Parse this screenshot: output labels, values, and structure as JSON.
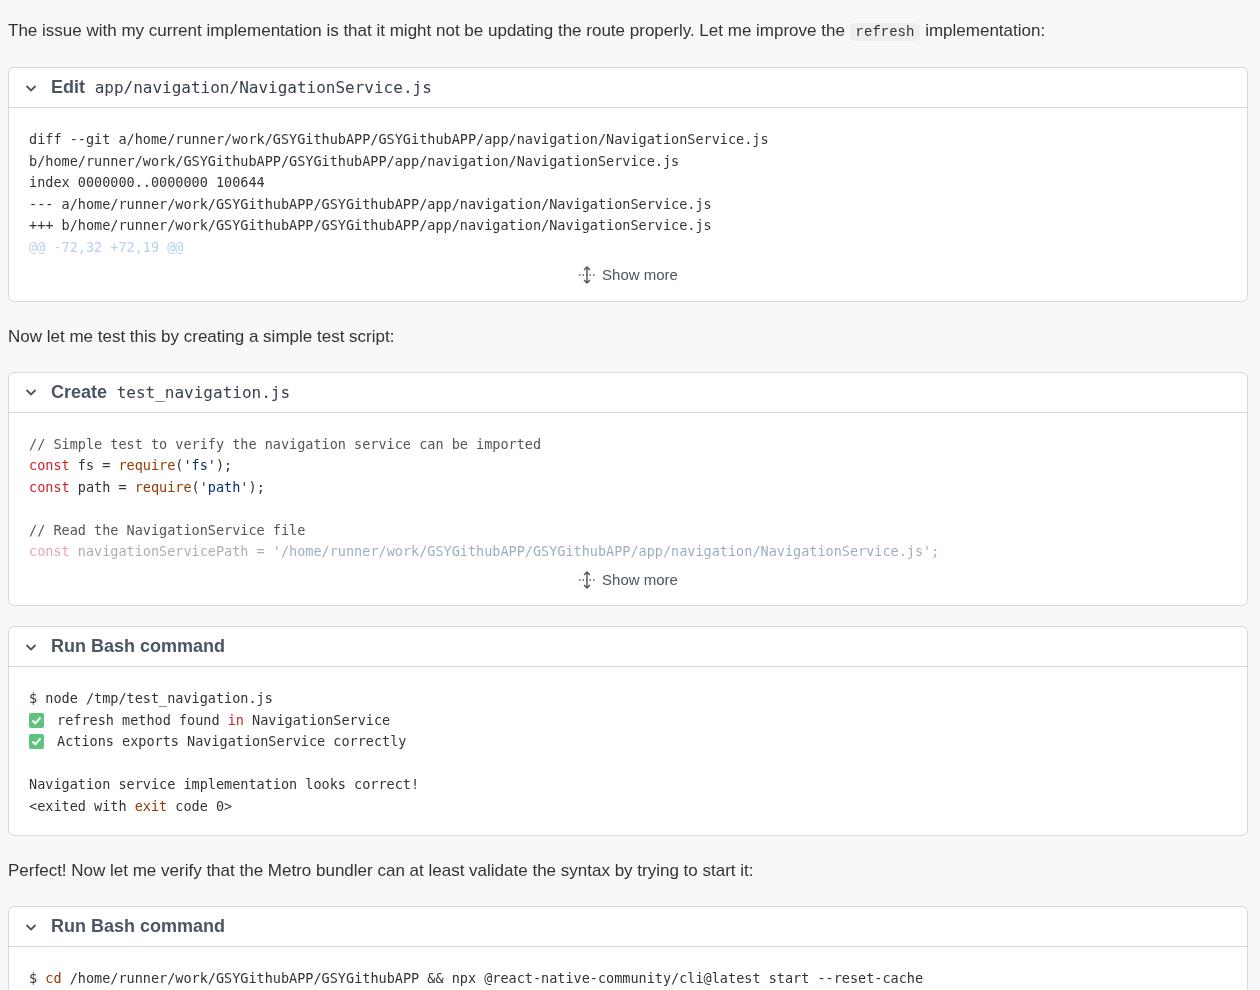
{
  "blocks": [
    {
      "kind": "text",
      "parts": [
        {
          "kind": "plain",
          "text": "The issue with my current implementation is that it might not be updating the route properly. Let me improve the "
        },
        {
          "kind": "code",
          "text": "refresh"
        },
        {
          "kind": "plain",
          "text": " implementation:"
        }
      ]
    },
    {
      "kind": "tool",
      "expanded": true,
      "action": "Edit",
      "target": "app/navigation/NavigationService.js",
      "show_more": "Show more",
      "lines": [
        {
          "kind": "line",
          "faded": false,
          "segs": [
            {
              "kind": "plain",
              "text": "diff --git a/home/runner/work/GSYGithubAPP/GSYGithubAPP/app/navigation/NavigationService.js"
            }
          ]
        },
        {
          "kind": "line",
          "faded": false,
          "segs": [
            {
              "kind": "plain",
              "text": "b/home/runner/work/GSYGithubAPP/GSYGithubAPP/app/navigation/NavigationService.js"
            }
          ]
        },
        {
          "kind": "line",
          "faded": false,
          "segs": [
            {
              "kind": "plain",
              "text": "index 0000000..0000000 100644"
            }
          ]
        },
        {
          "kind": "line",
          "faded": false,
          "segs": [
            {
              "kind": "plain",
              "text": "--- a/home/runner/work/GSYGithubAPP/GSYGithubAPP/app/navigation/NavigationService.js"
            }
          ]
        },
        {
          "kind": "line",
          "faded": false,
          "segs": [
            {
              "kind": "plain",
              "text": "+++ b/home/runner/work/GSYGithubAPP/GSYGithubAPP/app/navigation/NavigationService.js"
            }
          ]
        },
        {
          "kind": "line",
          "faded": true,
          "segs": [
            {
              "kind": "hunk",
              "text": "@@ -72,32 +72,19 @@"
            }
          ]
        }
      ]
    },
    {
      "kind": "text",
      "parts": [
        {
          "kind": "plain",
          "text": "Now let me test this by creating a simple test script:"
        }
      ]
    },
    {
      "kind": "tool",
      "expanded": true,
      "action": "Create",
      "target": "test_navigation.js",
      "show_more": "Show more",
      "lines": [
        {
          "kind": "line",
          "faded": false,
          "segs": [
            {
              "kind": "comment",
              "text": "// Simple test to verify the navigation service can be imported"
            }
          ]
        },
        {
          "kind": "line",
          "faded": false,
          "segs": [
            {
              "kind": "keyword",
              "text": "const"
            },
            {
              "kind": "plain",
              "text": " fs = "
            },
            {
              "kind": "builtin",
              "text": "require"
            },
            {
              "kind": "plain",
              "text": "("
            },
            {
              "kind": "string",
              "text": "'fs'"
            },
            {
              "kind": "plain",
              "text": ");"
            }
          ]
        },
        {
          "kind": "line",
          "faded": false,
          "segs": [
            {
              "kind": "keyword",
              "text": "const"
            },
            {
              "kind": "plain",
              "text": " path = "
            },
            {
              "kind": "builtin",
              "text": "require"
            },
            {
              "kind": "plain",
              "text": "("
            },
            {
              "kind": "string",
              "text": "'path'"
            },
            {
              "kind": "plain",
              "text": ");"
            }
          ]
        },
        {
          "kind": "blank"
        },
        {
          "kind": "line",
          "faded": false,
          "segs": [
            {
              "kind": "comment",
              "text": "// Read the NavigationService file"
            }
          ]
        },
        {
          "kind": "line",
          "faded": true,
          "segs": [
            {
              "kind": "keyword",
              "text": "const"
            },
            {
              "kind": "plain",
              "text": " navigationServicePath = "
            },
            {
              "kind": "string",
              "text": "'/home/runner/work/GSYGithubAPP/GSYGithubAPP/app/navigation/NavigationService.js'"
            },
            {
              "kind": "plain",
              "text": ";"
            }
          ]
        }
      ]
    },
    {
      "kind": "tool",
      "expanded": true,
      "action": "Run Bash command",
      "lines": [
        {
          "kind": "line",
          "faded": false,
          "segs": [
            {
              "kind": "plain",
              "text": "$ node /tmp/test_navigation.js"
            }
          ]
        },
        {
          "kind": "line",
          "faded": false,
          "segs": [
            {
              "kind": "check"
            },
            {
              "kind": "plain",
              "text": "refresh method found "
            },
            {
              "kind": "keyword",
              "text": "in"
            },
            {
              "kind": "plain",
              "text": " NavigationService"
            }
          ]
        },
        {
          "kind": "line",
          "faded": false,
          "segs": [
            {
              "kind": "check"
            },
            {
              "kind": "plain",
              "text": "Actions exports NavigationService correctly"
            }
          ]
        },
        {
          "kind": "blank"
        },
        {
          "kind": "line",
          "faded": false,
          "segs": [
            {
              "kind": "plain",
              "text": "Navigation service implementation looks correct!"
            }
          ]
        },
        {
          "kind": "line",
          "faded": false,
          "segs": [
            {
              "kind": "plain",
              "text": "<exited with "
            },
            {
              "kind": "builtin",
              "text": "exit"
            },
            {
              "kind": "plain",
              "text": " code 0>"
            }
          ]
        }
      ]
    },
    {
      "kind": "text",
      "parts": [
        {
          "kind": "plain",
          "text": "Perfect! Now let me verify that the Metro bundler can at least validate the syntax by trying to start it:"
        }
      ]
    },
    {
      "kind": "tool",
      "expanded": true,
      "action": "Run Bash command",
      "lines": [
        {
          "kind": "line",
          "faded": false,
          "segs": [
            {
              "kind": "plain",
              "text": "$ "
            },
            {
              "kind": "builtin",
              "text": "cd"
            },
            {
              "kind": "plain",
              "text": " /home/runner/work/GSYGithubAPP/GSYGithubAPP && npx @react-native-community/cli@latest start --reset-cache"
            }
          ]
        }
      ]
    }
  ]
}
